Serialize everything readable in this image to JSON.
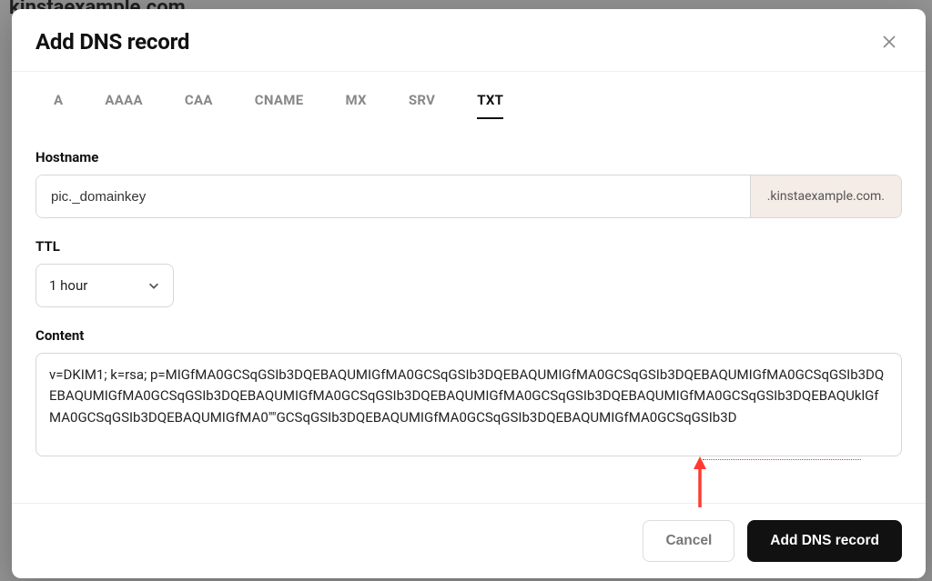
{
  "background": {
    "domain_title": "kinstaexample.com"
  },
  "modal": {
    "title": "Add DNS record",
    "tabs": [
      {
        "label": "A",
        "active": false
      },
      {
        "label": "AAAA",
        "active": false
      },
      {
        "label": "CAA",
        "active": false
      },
      {
        "label": "CNAME",
        "active": false
      },
      {
        "label": "MX",
        "active": false
      },
      {
        "label": "SRV",
        "active": false
      },
      {
        "label": "TXT",
        "active": true
      }
    ],
    "hostname": {
      "label": "Hostname",
      "value": "pic._domainkey",
      "suffix": ".kinstaexample.com."
    },
    "ttl": {
      "label": "TTL",
      "selected": "1 hour"
    },
    "content": {
      "label": "Content",
      "value": "v=DKIM1; k=rsa; p=MIGfMA0GCSqGSIb3DQEBAQUMIGfMA0GCSqGSIb3DQEBAQUMIGfMA0GCSqGSIb3DQEBAQUMIGfMA0GCSqGSIb3DQEBAQUMIGfMA0GCSqGSIb3DQEBAQUMIGfMA0GCSqGSIb3DQEBAQUMIGfMA0GCSqGSIb3DQEBAQUMIGfMA0GCSqGSIb3DQEBAQUklGfMA0GCSqGSIb3DQEBAQUMIGfMA0\"\"GCSqGSIb3DQEBAQUMIGfMA0GCSqGSIb3DQEBAQUMIGfMA0GCSqGSIb3D"
    },
    "footer": {
      "cancel": "Cancel",
      "submit": "Add DNS record"
    }
  }
}
